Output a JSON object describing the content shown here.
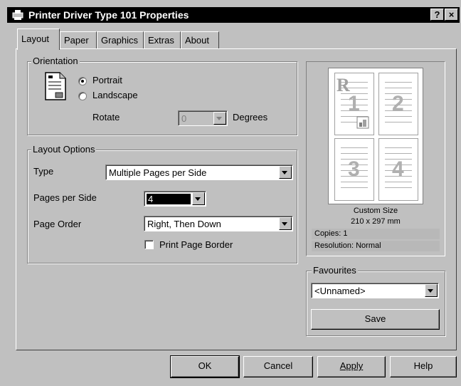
{
  "window": {
    "title": "Printer Driver Type 101 Properties",
    "help_btn": "?",
    "close_btn": "×"
  },
  "tabs": [
    {
      "label": "Layout",
      "active": true
    },
    {
      "label": "Paper"
    },
    {
      "label": "Graphics"
    },
    {
      "label": "Extras"
    },
    {
      "label": "About"
    }
  ],
  "orientation": {
    "group_label": "Orientation",
    "portrait_label": "Portrait",
    "landscape_label": "Landscape",
    "selected": "Portrait",
    "rotate_label": "Rotate",
    "rotate_value": "0",
    "degrees_label": "Degrees"
  },
  "layout_options": {
    "group_label": "Layout Options",
    "type_label": "Type",
    "type_value": "Multiple Pages per Side",
    "pages_per_side_label": "Pages per Side",
    "pages_per_side_value": "4",
    "page_order_label": "Page Order",
    "page_order_value": "Right, Then Down",
    "print_border_label": "Print Page Border",
    "print_border_checked": false
  },
  "preview": {
    "pages": [
      "1",
      "2",
      "3",
      "4"
    ],
    "watermark_letter": "R",
    "size_name": "Custom Size",
    "size_dims": "210 x 297 mm",
    "copies": "Copies: 1",
    "resolution": "Resolution: Normal"
  },
  "favourites": {
    "group_label": "Favourites",
    "value": "<Unnamed>",
    "save_label": "Save"
  },
  "buttons": {
    "ok": "OK",
    "cancel": "Cancel",
    "apply": "Apply",
    "help": "Help"
  },
  "colors": {
    "title_bar": "#000000",
    "face": "#c0c0c0",
    "highlight": "#000000"
  }
}
